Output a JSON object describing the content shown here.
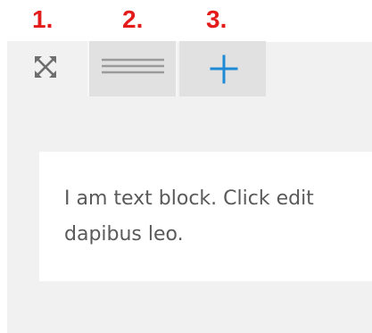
{
  "step_labels": [
    "1.",
    "2.",
    "3."
  ],
  "toolbar": {
    "expand_icon": "expand-arrows-icon",
    "drag_icon": "drag-handle-icon",
    "add_icon": "plus-icon"
  },
  "text_block": {
    "line1": "I am text block. Click edit",
    "line2": "dapibus leo."
  },
  "colors": {
    "step_label": "#e31b1b",
    "add_icon": "#1e8ad6",
    "panel": "#f1f1f1",
    "tab_active": "#e1e1e1"
  }
}
